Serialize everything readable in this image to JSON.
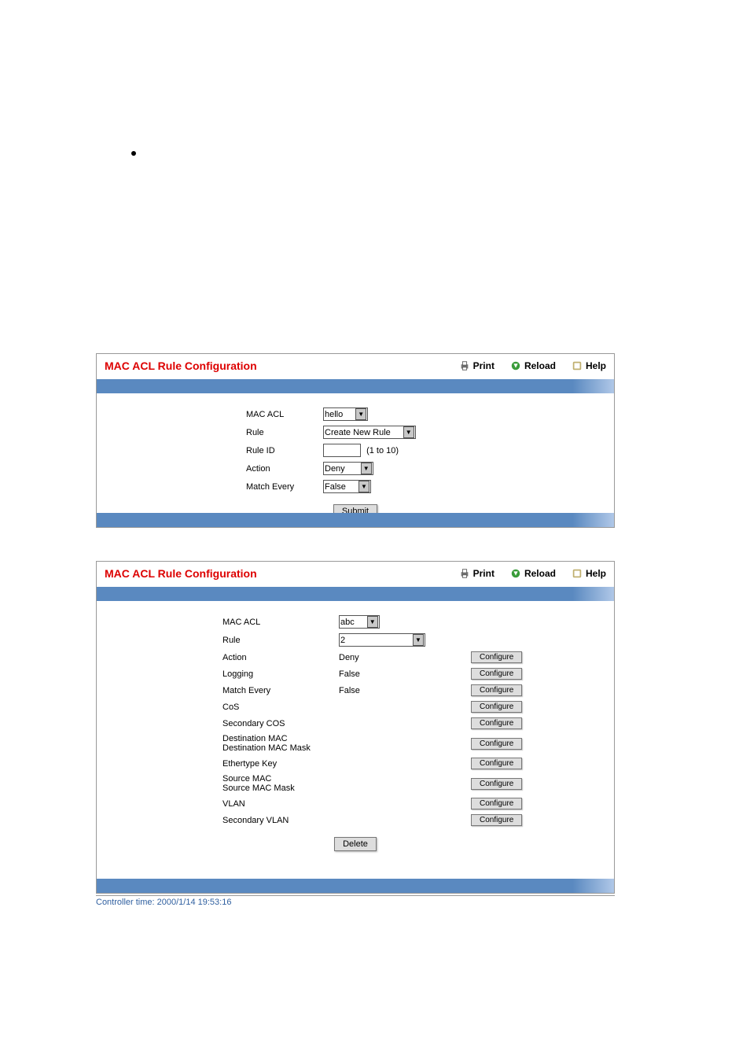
{
  "toolbar": {
    "print": "Print",
    "reload": "Reload",
    "help": "Help"
  },
  "panel1": {
    "title": "MAC ACL Rule Configuration",
    "fields": {
      "mac_acl_label": "MAC ACL",
      "mac_acl_value": "hello",
      "rule_label": "Rule",
      "rule_value": "Create New Rule",
      "rule_id_label": "Rule ID",
      "rule_id_value": "",
      "rule_id_hint": "(1 to 10)",
      "action_label": "Action",
      "action_value": "Deny",
      "match_every_label": "Match Every",
      "match_every_value": "False"
    },
    "submit_label": "Submit"
  },
  "panel2": {
    "title": "MAC ACL Rule Configuration",
    "fields": {
      "mac_acl_label": "MAC ACL",
      "mac_acl_value": "abc",
      "rule_label": "Rule",
      "rule_value": "2",
      "action_label": "Action",
      "action_value": "Deny",
      "logging_label": "Logging",
      "logging_value": "False",
      "match_every_label": "Match Every",
      "match_every_value": "False",
      "cos_label": "CoS",
      "secondary_cos_label": "Secondary COS",
      "dest_mac_label": "Destination MAC",
      "dest_mac_mask_label": "Destination MAC Mask",
      "ethertype_label": "Ethertype Key",
      "source_mac_label": "Source MAC",
      "source_mac_mask_label": "Source MAC Mask",
      "vlan_label": "VLAN",
      "secondary_vlan_label": "Secondary VLAN"
    },
    "configure_label": "Configure",
    "delete_label": "Delete"
  },
  "footer_time": "Controller time: 2000/1/14 19:53:16"
}
